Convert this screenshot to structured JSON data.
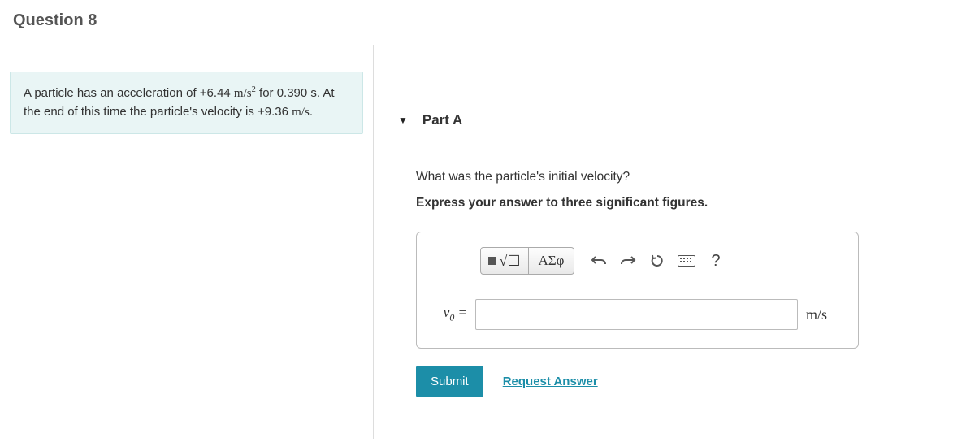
{
  "question_header": "Question 8",
  "prompt": {
    "pre": "A particle has an acceleration of +6.44 ",
    "accel_unit_base": "m/s",
    "accel_unit_exp": "2",
    "mid": " for 0.390 s. At the end of this time the particle's velocity is +9.36 ",
    "vel_unit": "m/s",
    "post": "."
  },
  "part": {
    "label": "Part A",
    "question": "What was the particle's initial velocity?",
    "instruction": "Express your answer to three significant figures."
  },
  "toolbar": {
    "templates_label": "templates",
    "symbols_label": "ΑΣφ",
    "help_label": "?"
  },
  "answer": {
    "var_html_base": "v",
    "var_html_sub": "0",
    "var_eq": " =",
    "value": "",
    "unit": "m/s"
  },
  "buttons": {
    "submit": "Submit",
    "request": "Request Answer"
  }
}
